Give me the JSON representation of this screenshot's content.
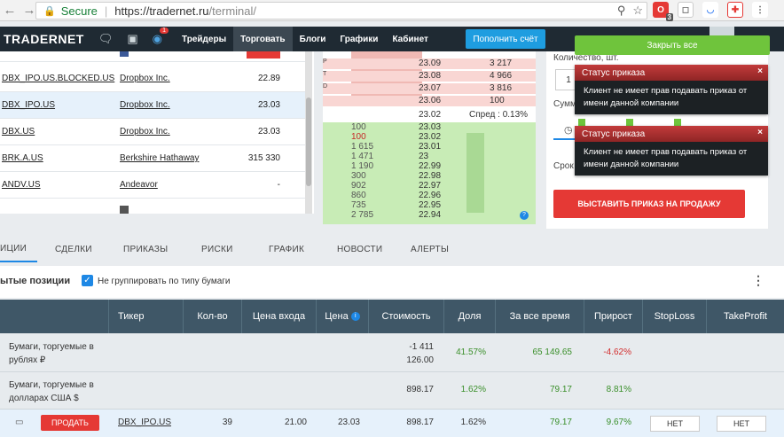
{
  "browser": {
    "back": "←",
    "forward": "→",
    "secure_label": "Secure",
    "url_host": "https://tradernet.ru",
    "url_path": "/terminal/",
    "ext_badge": "3"
  },
  "header": {
    "logo_main": "TRADER",
    "logo_accent": "NET",
    "globe_badge": "1",
    "nav": [
      "Трейдеры",
      "Торговать",
      "Блоги",
      "Графики",
      "Кабинет"
    ],
    "active_nav": "Торговать",
    "topup": "Пополнить счёт"
  },
  "instruments": [
    {
      "ticker": "DBX_IPO.US.BLOCKED.US",
      "name": "Dropbox Inc.",
      "price": "22.89"
    },
    {
      "ticker": "DBX_IPO.US",
      "name": "Dropbox Inc.",
      "price": "23.03",
      "selected": true
    },
    {
      "ticker": "DBX.US",
      "name": "Dropbox Inc.",
      "price": "23.03"
    },
    {
      "ticker": "BRK.A.US",
      "name": "Berkshire Hathaway",
      "price": "315 330"
    },
    {
      "ticker": "ANDV.US",
      "name": "Andeavor",
      "price": "-"
    }
  ],
  "orderbook": {
    "asks": [
      {
        "price": "23.09",
        "qty": "3 217",
        "side": "Р"
      },
      {
        "price": "23.08",
        "qty": "4 966",
        "side": "Т"
      },
      {
        "price": "23.07",
        "qty": "3 816",
        "side": "D"
      },
      {
        "price": "23.06",
        "qty": "100",
        "side": ""
      }
    ],
    "spread_price": "23.02",
    "spread_label": "Спред : 0.13%",
    "bids": [
      {
        "qty": "100",
        "price": "23.03"
      },
      {
        "qty": "100",
        "price": "23.02",
        "red": true
      },
      {
        "qty": "1 615",
        "price": "23.01"
      },
      {
        "qty": "1 471",
        "price": "23"
      },
      {
        "qty": "1 190",
        "price": "22.99"
      },
      {
        "qty": "300",
        "price": "22.98"
      },
      {
        "qty": "902",
        "price": "22.97"
      },
      {
        "qty": "860",
        "price": "22.96"
      },
      {
        "qty": "735",
        "price": "22.95"
      },
      {
        "qty": "2 785",
        "price": "22.94"
      }
    ],
    "help": "?"
  },
  "order_panel": {
    "quantity_label": "Количество, шт.",
    "quantity_value": "1",
    "sum_label": "Сумм",
    "term_label": "Срок",
    "close_all": "Закрыть все",
    "sell_order": "ВЫСТАВИТЬ ПРИКАЗ НА ПРОДАЖУ"
  },
  "toasts": [
    {
      "title": "Статус приказа",
      "body": "Клиент не имеет прав подавать приказ от имени данной компании"
    },
    {
      "title": "Статус приказа",
      "body": "Клиент не имеет прав подавать приказ от имени данной компании"
    }
  ],
  "tabs": [
    "ИЦИИ",
    "СДЕЛКИ",
    "ПРИКАЗЫ",
    "РИСКИ",
    "ГРАФИК",
    "НОВОСТИ",
    "АЛЕРТЫ"
  ],
  "positions": {
    "title": "ытые позиции",
    "checkbox_label": "Не группировать по типу бумаги",
    "columns": [
      "Тикер",
      "Кол-во",
      "Цена входа",
      "Цена",
      "Стоимость",
      "Доля",
      "За все время",
      "Прирост",
      "StopLoss",
      "TakeProfit"
    ],
    "groups": [
      {
        "label_line1": "Бумаги, торгуемые в",
        "label_line2": "рублях ₽",
        "value_line1": "-1 411",
        "value_line2": "126.00",
        "share": "41.57%",
        "alltime": "65 149.65",
        "growth": "-4.62%"
      },
      {
        "label_line1": "Бумаги, торгуемые в",
        "label_line2": "долларах США $",
        "value": "898.17",
        "share": "1.62%",
        "alltime": "79.17",
        "growth": "8.81%"
      }
    ],
    "row": {
      "sell": "ПРОДАТЬ",
      "ticker": "DBX_IPO.US",
      "qty": "39",
      "entry": "21.00",
      "price": "23.03",
      "value": "898.17",
      "share": "1.62%",
      "alltime": "79.17",
      "growth": "9.67%",
      "stoploss": "НЕТ",
      "takeprofit": "НЕТ"
    }
  }
}
